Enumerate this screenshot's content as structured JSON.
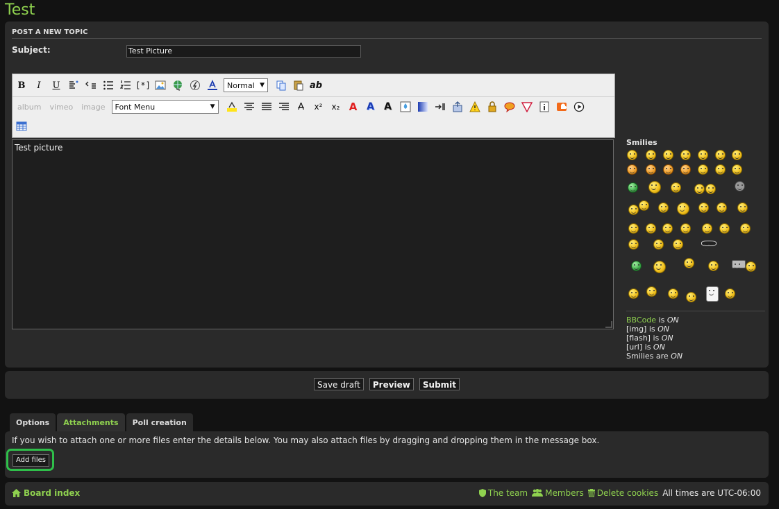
{
  "page_title": "Test",
  "form": {
    "section_title": "POST A NEW TOPIC",
    "subject_label": "Subject:",
    "subject_value": "Test Picture",
    "message_text": "Test picture"
  },
  "toolbar": {
    "font_size_select": "Normal",
    "font_menu_select": "Font Menu",
    "album_label": "album",
    "vimeo_label": "vimeo",
    "image_label": "image",
    "bold": "B",
    "italic": "I",
    "underline": "U",
    "text_ab": "ab",
    "superscript": "x²",
    "subscript": "x₂"
  },
  "smilies": {
    "title": "Smilies"
  },
  "bbcode": {
    "bbcode_link": "BBCode",
    "is": " is ",
    "on": "ON",
    "img": "[img]",
    "flash": "[flash]",
    "url": "[url]",
    "smilies_are": "Smilies are ",
    "on2": "ON",
    "on3": "ON",
    "on4": "ON",
    "on5": "ON",
    "is2": " is ",
    "is3": " is ",
    "is4": " is "
  },
  "buttons": {
    "save_draft": "Save draft",
    "preview": "Preview",
    "submit": "Submit"
  },
  "tabs": {
    "options": "Options",
    "attachments": "Attachments",
    "poll_creation": "Poll creation"
  },
  "attachments": {
    "instructions": "If you wish to attach one or more files enter the details below. You may also attach files by dragging and dropping them in the message box.",
    "add_files": "Add files"
  },
  "footer": {
    "board_index": "Board index",
    "the_team": "The team",
    "members": "Members",
    "delete_cookies": "Delete cookies",
    "timezone": "All times are UTC-06:00"
  },
  "colors": {
    "accent": "#8fd14f",
    "highlight_ring": "#2fbf4a",
    "background": "#121212",
    "panel": "#2a2a2a"
  }
}
